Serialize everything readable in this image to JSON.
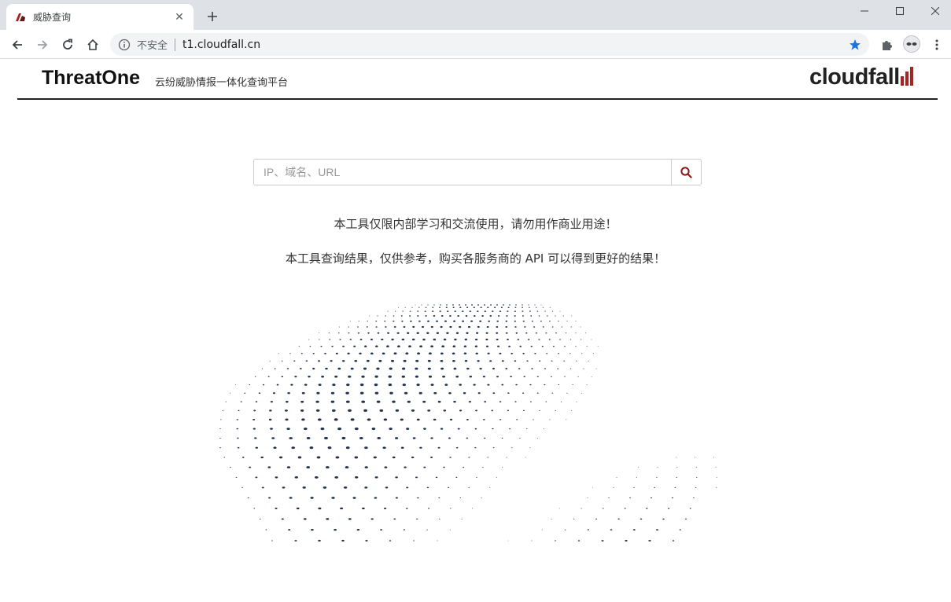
{
  "browser": {
    "tab": {
      "title": "威胁查询"
    },
    "address_bar": {
      "security_label": "不安全",
      "url": "t1.cloudfall.cn"
    }
  },
  "header": {
    "brand": "ThreatOne",
    "slogan": "云纷威胁情报一体化查询平台",
    "logo": "cloudfall"
  },
  "search": {
    "placeholder": "IP、域名、URL",
    "value": ""
  },
  "notices": [
    "本工具仅限内部学习和交流使用，请勿用作商业用途！",
    "本工具查询结果，仅供参考，购买各服务商的 API 可以得到更好的结果！"
  ],
  "colors": {
    "accent": "#8b1a1a",
    "dots": "#233350",
    "logo_red": "#b0201e"
  }
}
